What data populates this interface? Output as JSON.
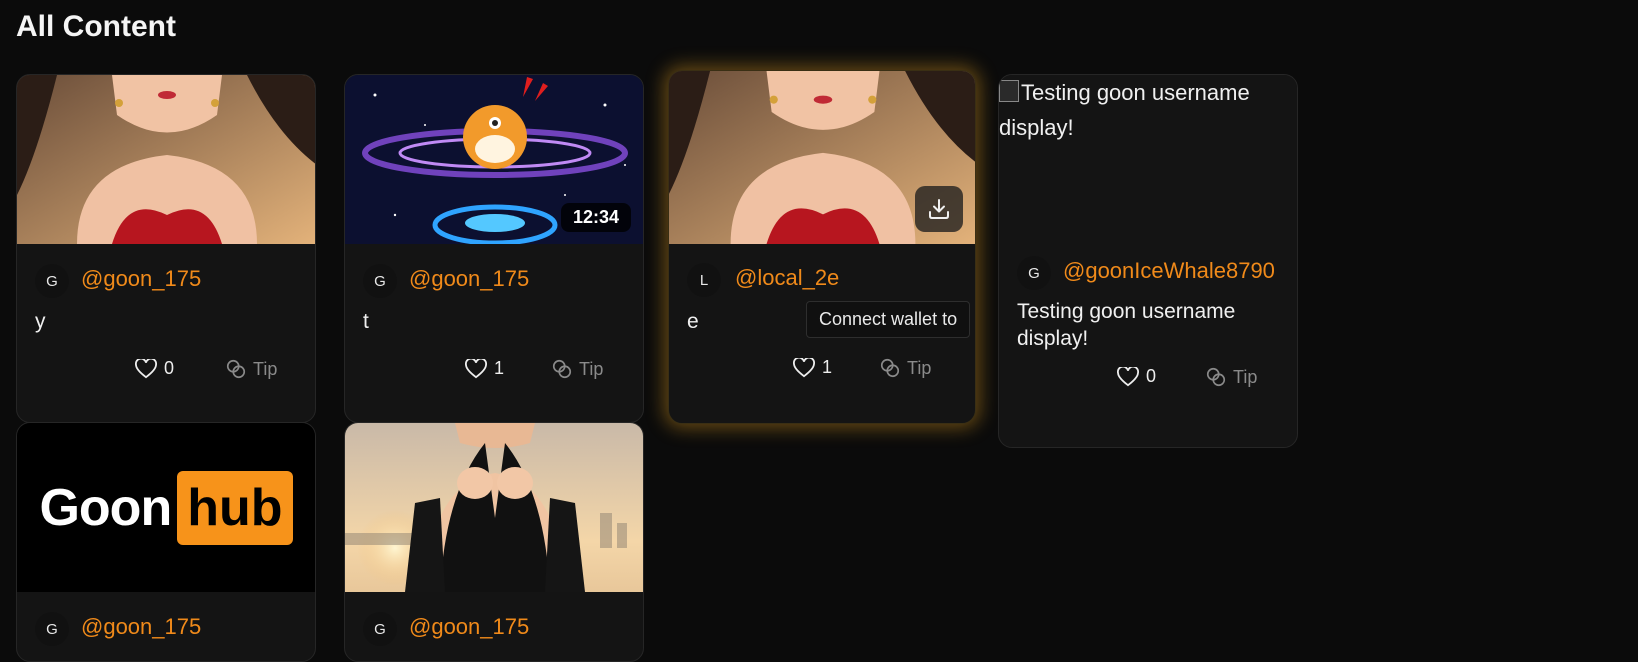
{
  "page_title": "All Content",
  "actions": {
    "tip_label": "Tip"
  },
  "posts": [
    {
      "avatar_letter": "G",
      "username": "@goon_175",
      "caption": "y",
      "likes": "0"
    },
    {
      "avatar_letter": "G",
      "username": "@goon_175",
      "caption": "t",
      "likes": "1",
      "duration": "12:34"
    },
    {
      "avatar_letter": "L",
      "username": "@local_2e",
      "caption": "e",
      "likes": "1",
      "tooltip": "Connect wallet to"
    },
    {
      "avatar_letter": "G",
      "username": "@goonIceWhale8790",
      "caption": "Testing goon username display!",
      "likes": "0",
      "image_alt": "Testing goon username display!"
    },
    {
      "avatar_letter": "G",
      "username": "@goon_175",
      "logo_text": "Goon",
      "logo_badge": "hub"
    },
    {
      "avatar_letter": "G",
      "username": "@goon_175"
    }
  ],
  "colors": {
    "accent": "#f08a1a",
    "logo_badge": "#f7931a",
    "glow": "#d6961e"
  }
}
